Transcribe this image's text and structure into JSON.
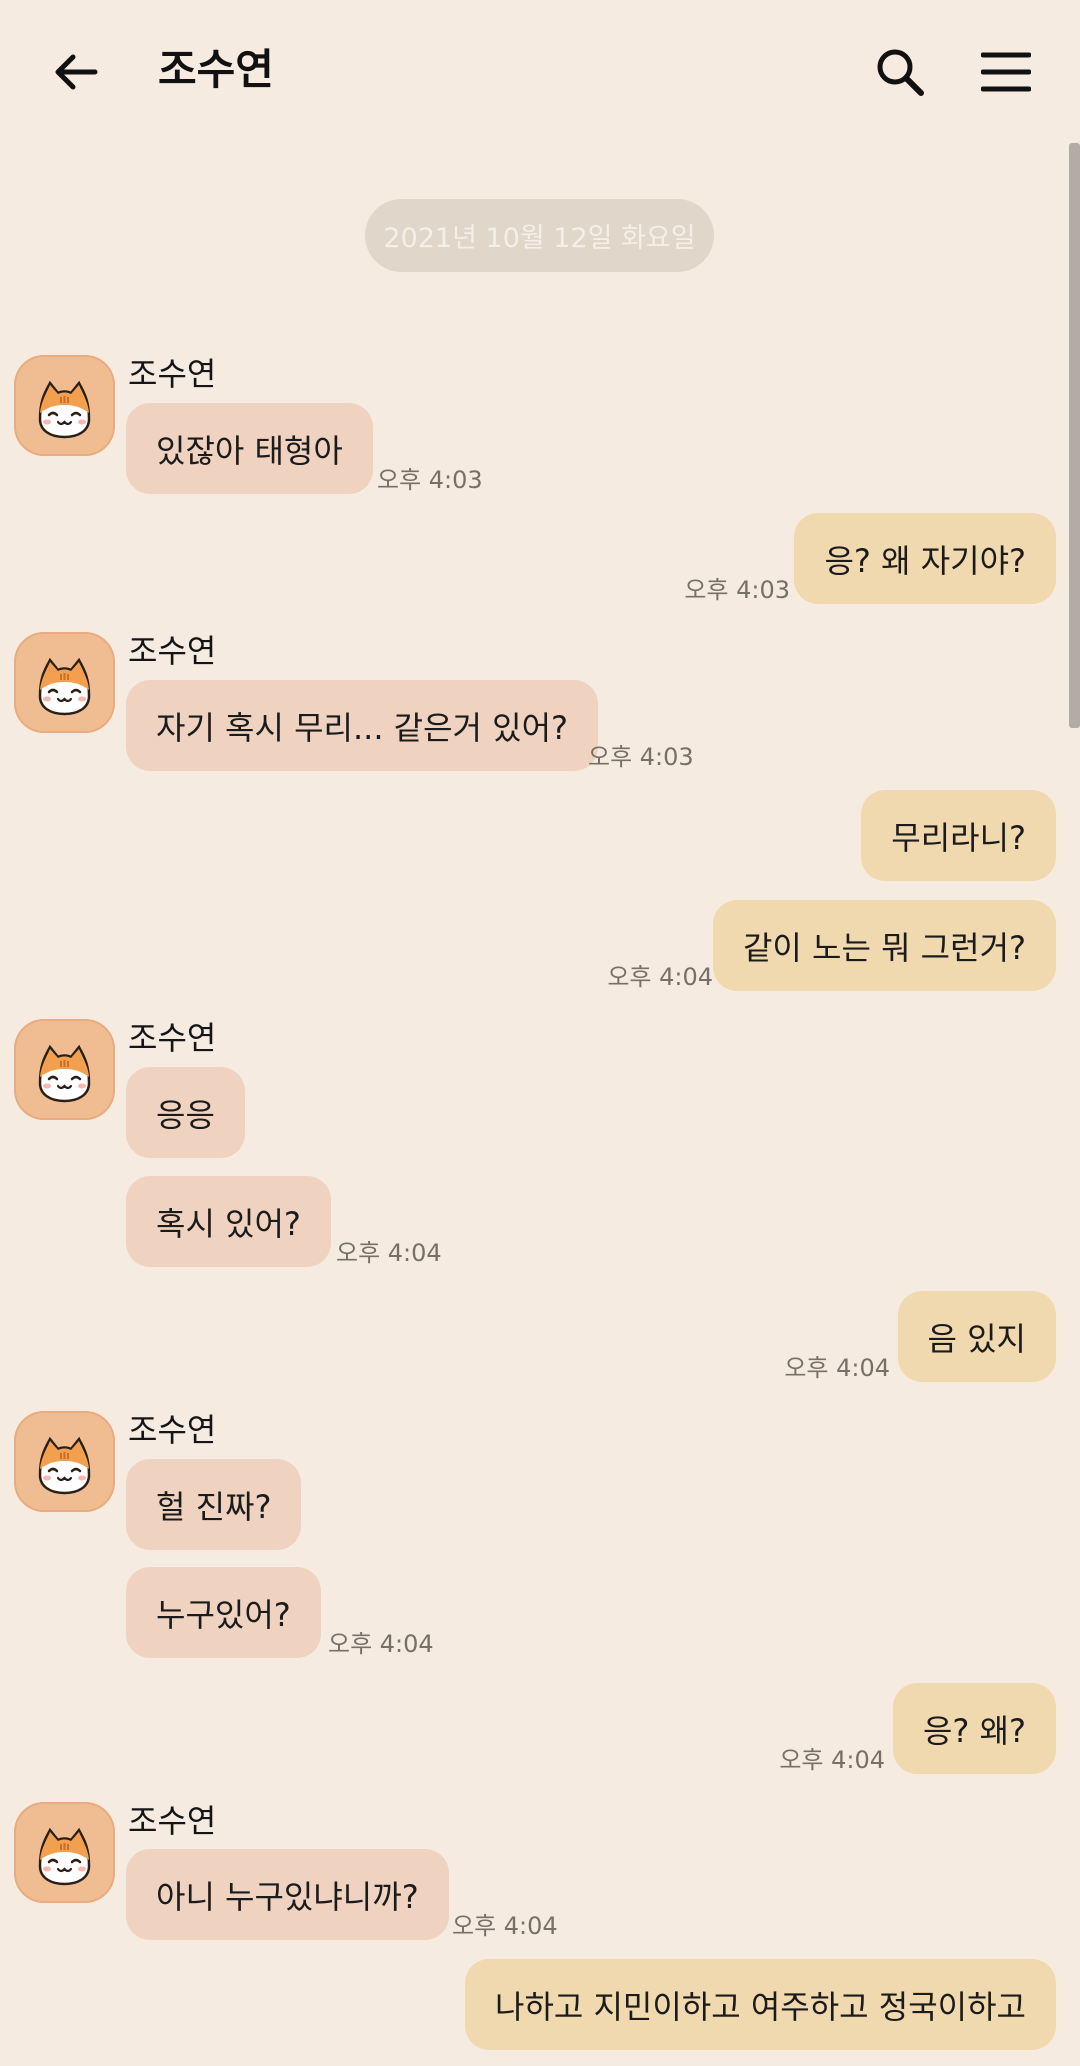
{
  "header": {
    "title": "조수연",
    "back_icon": "arrow-left-icon",
    "search_icon": "search-icon",
    "menu_icon": "hamburger-menu-icon"
  },
  "chat": {
    "date": "2021년 10월 12일 화요일",
    "avatar_icon": "cat-face-icon",
    "colors": {
      "background": "#f6ebe0",
      "incoming_bubble": "#efd3c0",
      "outgoing_bubble": "#f1d9af",
      "avatar": "#f0bd93"
    },
    "messages": [
      {
        "from": "조수연",
        "text": "있잖아 태형아",
        "time": "오후 4:03"
      },
      {
        "from": "me",
        "text": "응? 왜 자기야?",
        "time": "오후 4:03"
      },
      {
        "from": "조수연",
        "text": "자기 혹시 무리... 같은거 있어?",
        "time": "오후 4:03"
      },
      {
        "from": "me",
        "text": "무리라니?",
        "time": ""
      },
      {
        "from": "me",
        "text": "같이 노는 뭐 그런거?",
        "time": "오후 4:04"
      },
      {
        "from": "조수연",
        "text": "응응",
        "time": ""
      },
      {
        "from": "조수연",
        "text": "혹시 있어?",
        "time": "오후 4:04"
      },
      {
        "from": "me",
        "text": "음 있지",
        "time": "오후 4:04"
      },
      {
        "from": "조수연",
        "text": "헐 진짜?",
        "time": ""
      },
      {
        "from": "조수연",
        "text": "누구있어?",
        "time": "오후 4:04"
      },
      {
        "from": "me",
        "text": "응? 왜?",
        "time": "오후 4:04"
      },
      {
        "from": "조수연",
        "text": "아니 누구있냐니까?",
        "time": "오후 4:04"
      },
      {
        "from": "me",
        "text": "나하고 지민이하고 여주하고 정국이하고",
        "time": ""
      }
    ]
  }
}
